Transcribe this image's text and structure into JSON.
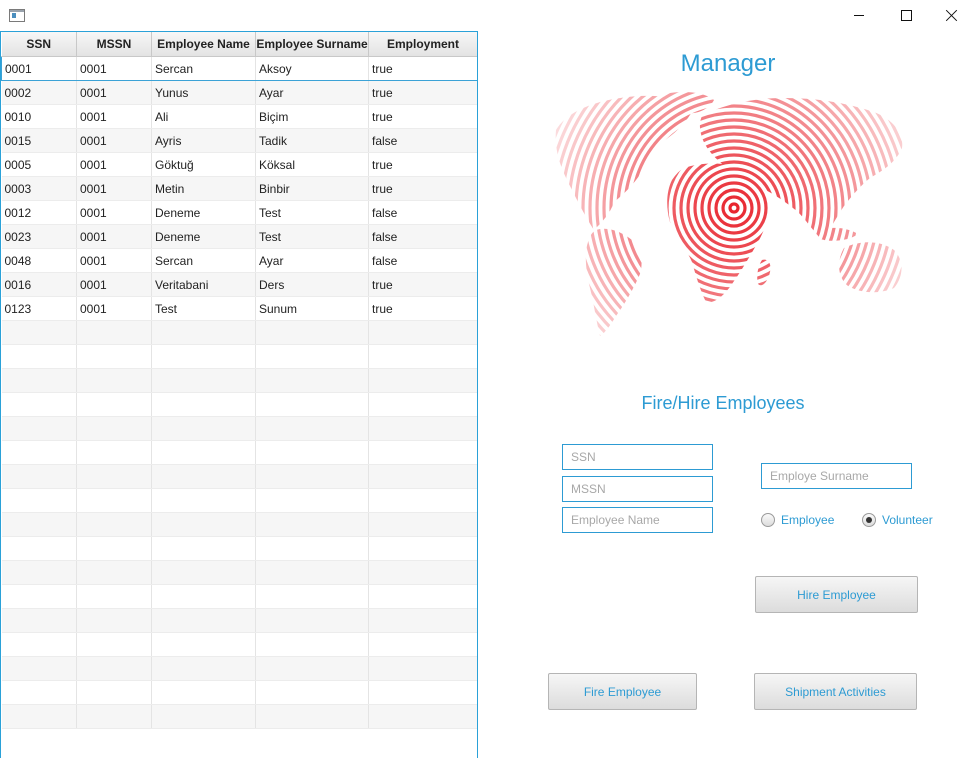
{
  "window": {
    "controls": {
      "minimize_icon": "minimize-icon",
      "maximize_icon": "maximize-icon",
      "close_icon": "close-icon"
    }
  },
  "table": {
    "columns": [
      "SSN",
      "MSSN",
      "Employee Name",
      "Employee Surname",
      "Employment"
    ],
    "rows": [
      [
        "0001",
        "0001",
        "Sercan",
        "Aksoy",
        "true"
      ],
      [
        "0002",
        "0001",
        "Yunus",
        "Ayar",
        "true"
      ],
      [
        "0010",
        "0001",
        "Ali",
        "Biçim",
        "true"
      ],
      [
        "0015",
        "0001",
        "Ayris",
        "Tadik",
        "false"
      ],
      [
        "0005",
        "0001",
        "Göktuğ",
        "Köksal",
        "true"
      ],
      [
        "0003",
        "0001",
        "Metin",
        "Binbir",
        "true"
      ],
      [
        "0012",
        "0001",
        "Deneme",
        "Test",
        "false"
      ],
      [
        "0023",
        "0001",
        "Deneme",
        "Test",
        "false"
      ],
      [
        "0048",
        "0001",
        "Sercan",
        "Ayar",
        "false"
      ],
      [
        "0016",
        "0001",
        "Veritabani",
        "Ders",
        "true"
      ],
      [
        "0123",
        "0001",
        "Test",
        "Sunum",
        "true"
      ]
    ],
    "selected_row": 0
  },
  "header": {
    "title": "Manager"
  },
  "form": {
    "title": "Fire/Hire Employees",
    "ssn_placeholder": "SSN",
    "mssn_placeholder": "MSSN",
    "name_placeholder": "Employee Name",
    "surname_placeholder": "Employe Surname",
    "radio_employee": "Employee",
    "radio_volunteer": "Volunteer",
    "selected_type": "Volunteer",
    "hire_button": "Hire Employee",
    "fire_button": "Fire Employee",
    "shipment_button": "Shipment Activities"
  },
  "colors": {
    "accent": "#2d9bd3",
    "map_red": "#e8222b"
  }
}
